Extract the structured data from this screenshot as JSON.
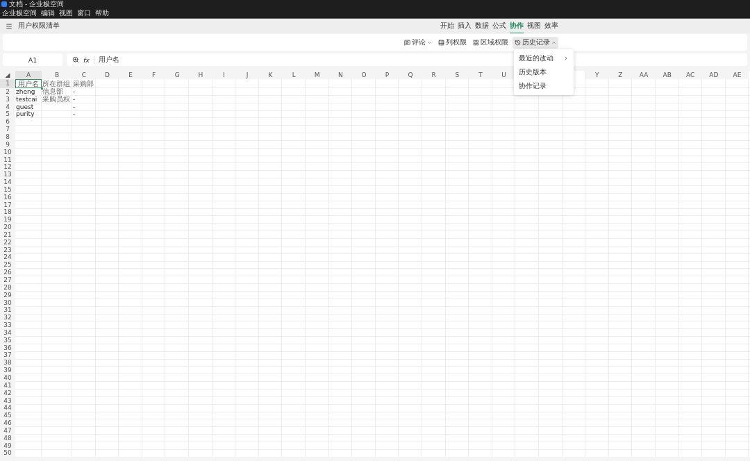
{
  "window": {
    "title": "文档 - 企业极空间"
  },
  "menu_bar": [
    "企业极空间",
    "编辑",
    "视图",
    "窗口",
    "帮助"
  ],
  "document": {
    "title": "用户权限清单"
  },
  "ribbon_tabs": [
    {
      "label": "开始",
      "selected": false
    },
    {
      "label": "插入",
      "selected": false
    },
    {
      "label": "数据",
      "selected": false
    },
    {
      "label": "公式",
      "selected": false
    },
    {
      "label": "协作",
      "selected": true
    },
    {
      "label": "视图",
      "selected": false
    },
    {
      "label": "效率",
      "selected": false
    }
  ],
  "toolbar": [
    {
      "kind": "comment",
      "label": "评论",
      "expanded": false
    },
    {
      "kind": "column",
      "label": "列权限"
    },
    {
      "kind": "region",
      "label": "区域权限"
    },
    {
      "kind": "history",
      "label": "历史记录",
      "expanded": true
    }
  ],
  "formula_bar": {
    "cell_ref": "A1",
    "fx": "fx",
    "value": "用户名"
  },
  "dropdown_menu": [
    {
      "label": "最近的改动",
      "submenu": true
    },
    {
      "label": "历史版本",
      "submenu": false
    },
    {
      "label": "协作记录",
      "submenu": false
    }
  ],
  "sheet": {
    "corner": "◢",
    "columns": [
      {
        "label": "A"
      },
      {
        "label": "B"
      },
      {
        "label": "C"
      },
      {
        "label": "D"
      },
      {
        "label": "E"
      },
      {
        "label": "F"
      },
      {
        "label": "G"
      },
      {
        "label": "H"
      },
      {
        "label": "I"
      },
      {
        "label": "J"
      },
      {
        "label": "K"
      },
      {
        "label": "L"
      },
      {
        "label": "M"
      },
      {
        "label": "N"
      },
      {
        "label": "O"
      },
      {
        "label": "P"
      },
      {
        "label": "Q"
      },
      {
        "label": "R"
      },
      {
        "label": "S"
      },
      {
        "label": "T"
      },
      {
        "label": "U"
      },
      {},
      {},
      {},
      {
        "label": "Y"
      },
      {
        "label": "Z"
      },
      {
        "label": "AA"
      },
      {
        "label": "AB"
      },
      {
        "label": "AC"
      },
      {
        "label": "AD"
      },
      {
        "label": "AE"
      }
    ],
    "rows": [
      {
        "header": "1",
        "cells": [
          {
            "text": "用户名",
            "selected": true
          },
          {
            "text": "所在群组",
            "selected": false
          },
          {
            "text": "采购部",
            "selected": false
          }
        ]
      },
      {
        "header": "2",
        "cells": [
          {
            "text": "zheng",
            "selected": false
          },
          {
            "text": "信息部",
            "selected": false
          },
          {
            "text": "-",
            "selected": false
          }
        ]
      },
      {
        "header": "3",
        "cells": [
          {
            "text": "testcai",
            "selected": false
          },
          {
            "text": "采购员权",
            "selected": false
          },
          {
            "text": "-",
            "selected": false
          }
        ]
      },
      {
        "header": "4",
        "cells": [
          {
            "text": "guest",
            "selected": false
          },
          {
            "selected": false
          },
          {
            "text": "-",
            "selected": false
          }
        ]
      },
      {
        "header": "5",
        "cells": [
          {
            "text": "purity",
            "selected": false
          },
          {
            "selected": false
          },
          {
            "text": "-",
            "selected": false
          }
        ]
      },
      {
        "header": "6"
      },
      {
        "header": "7"
      },
      {
        "header": "8"
      },
      {
        "header": "9"
      },
      {
        "header": "10"
      },
      {
        "header": "11"
      },
      {
        "header": "12"
      },
      {
        "header": "13"
      },
      {
        "header": "14"
      },
      {
        "header": "15"
      },
      {
        "header": "16"
      },
      {
        "header": "17"
      },
      {
        "header": "18"
      },
      {
        "header": "19"
      },
      {
        "header": "20"
      },
      {
        "header": "21"
      },
      {
        "header": "22"
      },
      {
        "header": "23"
      },
      {
        "header": "24"
      },
      {
        "header": "25"
      },
      {
        "header": "26"
      },
      {
        "header": "27"
      },
      {
        "header": "28"
      },
      {
        "header": "29"
      },
      {
        "header": "30"
      },
      {
        "header": "31"
      },
      {
        "header": "32"
      },
      {
        "header": "33"
      },
      {
        "header": "34"
      },
      {
        "header": "35"
      },
      {
        "header": "36"
      },
      {
        "header": "37"
      },
      {
        "header": "38"
      },
      {
        "header": "39"
      },
      {
        "header": "40"
      },
      {
        "header": "41"
      },
      {
        "header": "42"
      },
      {
        "header": "43"
      },
      {
        "header": "44"
      },
      {
        "header": "45"
      },
      {
        "header": "46"
      },
      {
        "header": "47"
      },
      {
        "header": "48"
      },
      {
        "header": "49"
      },
      {
        "header": "50"
      }
    ]
  }
}
